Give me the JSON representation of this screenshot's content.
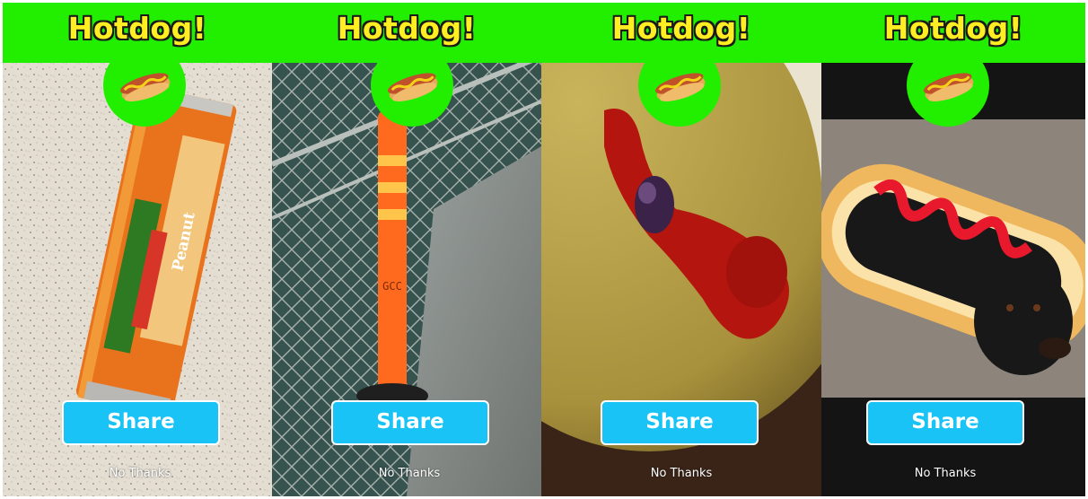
{
  "panels": [
    {
      "title": "Hotdog!",
      "badge_icon": "hotdog-icon",
      "share_label": "Share",
      "dismiss_label": "No Thanks",
      "photo_label": "Peanut"
    },
    {
      "title": "Hotdog!",
      "badge_icon": "hotdog-icon",
      "share_label": "Share",
      "dismiss_label": "No Thanks",
      "photo_label": "GCC"
    },
    {
      "title": "Hotdog!",
      "badge_icon": "hotdog-icon",
      "share_label": "Share",
      "dismiss_label": "No Thanks"
    },
    {
      "title": "Hotdog!",
      "badge_icon": "hotdog-icon",
      "share_label": "Share",
      "dismiss_label": "No Thanks"
    }
  ],
  "colors": {
    "banner": "#22ee00",
    "title_text": "#ffee22",
    "share_button": "#19c3f5"
  }
}
